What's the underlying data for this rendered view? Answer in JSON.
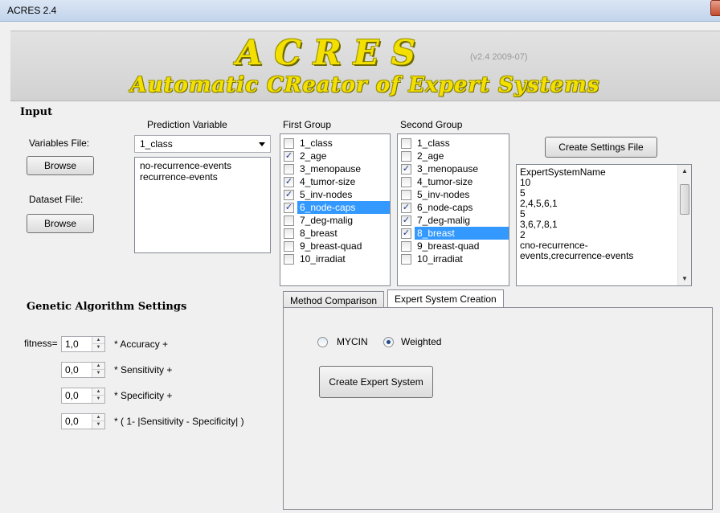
{
  "window": {
    "title": "ACRES 2.4"
  },
  "banner": {
    "logo": "ACRES",
    "version": "(v2.4  2009-07)",
    "subtitle": "Automatic CReator of Expert Systems"
  },
  "input": {
    "section_title": "Input",
    "variables_file_label": "Variables File:",
    "variables_browse": "Browse",
    "dataset_file_label": "Dataset File:",
    "dataset_browse": "Browse"
  },
  "prediction": {
    "label": "Prediction Variable",
    "selected": "1_class",
    "values": [
      "no-recurrence-events",
      "recurrence-events"
    ]
  },
  "first_group": {
    "label": "First Group",
    "items": [
      {
        "label": "1_class",
        "checked": false,
        "selected": false
      },
      {
        "label": "2_age",
        "checked": true,
        "selected": false
      },
      {
        "label": "3_menopause",
        "checked": false,
        "selected": false
      },
      {
        "label": "4_tumor-size",
        "checked": true,
        "selected": false
      },
      {
        "label": "5_inv-nodes",
        "checked": true,
        "selected": false
      },
      {
        "label": "6_node-caps",
        "checked": true,
        "selected": true
      },
      {
        "label": "7_deg-malig",
        "checked": false,
        "selected": false
      },
      {
        "label": "8_breast",
        "checked": false,
        "selected": false
      },
      {
        "label": "9_breast-quad",
        "checked": false,
        "selected": false
      },
      {
        "label": "10_irradiat",
        "checked": false,
        "selected": false
      }
    ]
  },
  "second_group": {
    "label": "Second Group",
    "items": [
      {
        "label": "1_class",
        "checked": false,
        "selected": false
      },
      {
        "label": "2_age",
        "checked": false,
        "selected": false
      },
      {
        "label": "3_menopause",
        "checked": true,
        "selected": false
      },
      {
        "label": "4_tumor-size",
        "checked": false,
        "selected": false
      },
      {
        "label": "5_inv-nodes",
        "checked": false,
        "selected": false
      },
      {
        "label": "6_node-caps",
        "checked": true,
        "selected": false
      },
      {
        "label": "7_deg-malig",
        "checked": true,
        "selected": false
      },
      {
        "label": "8_breast",
        "checked": true,
        "selected": true
      },
      {
        "label": "9_breast-quad",
        "checked": false,
        "selected": false
      },
      {
        "label": "10_irradiat",
        "checked": false,
        "selected": false
      }
    ]
  },
  "settings": {
    "create_button": "Create Settings File",
    "lines": [
      "ExpertSystemName",
      "10",
      "5",
      "2,4,5,6,1",
      "5",
      "3,6,7,8,1",
      "2",
      "cno-recurrence-",
      "events,crecurrence-events"
    ]
  },
  "genetic": {
    "section_title": "Genetic Algorithm Settings",
    "fitness_label": "fitness=",
    "rows": [
      {
        "value": "1,0",
        "suffix": "* Accuracy  +"
      },
      {
        "value": "0,0",
        "suffix": "* Sensitivity  +"
      },
      {
        "value": "0,0",
        "suffix": "* Specificity  +"
      },
      {
        "value": "0,0",
        "suffix": "* ( 1- |Sensitivity - Specificity| )"
      }
    ]
  },
  "tabs": {
    "items": [
      "Method Comparison",
      "Expert System Creation"
    ],
    "active": 1
  },
  "expert_creation": {
    "mycin_label": "MYCIN",
    "weighted_label": "Weighted",
    "selected_method": "Weighted",
    "create_button": "Create Expert System"
  },
  "colors": {
    "selection": "#3399ff",
    "logo_yellow": "#f4e000"
  }
}
